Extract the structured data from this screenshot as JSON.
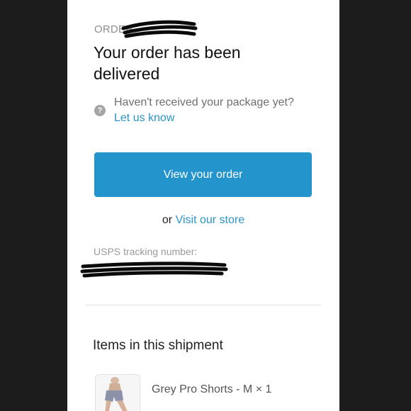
{
  "order": {
    "prefix": "ORDER",
    "title": "Your order has been delivered"
  },
  "help": {
    "icon": "help-circle-icon",
    "question": "Haven't received your package yet?",
    "link": "Let us know"
  },
  "actions": {
    "view_order": "View your order",
    "or_text": "or",
    "visit_store": "Visit our store"
  },
  "tracking": {
    "label": "USPS tracking number:"
  },
  "shipment": {
    "title": "Items in this shipment",
    "items": [
      {
        "name": "Grey Pro Shorts - M × 1"
      }
    ]
  },
  "colors": {
    "accent": "#2394cc",
    "link": "#2b94c8",
    "background": "#1c1c1c"
  }
}
